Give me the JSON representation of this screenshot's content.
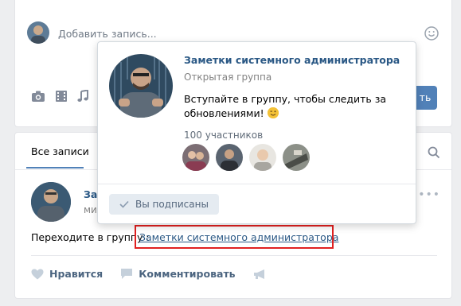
{
  "composer": {
    "placeholder": "Добавить запись...",
    "publish_label": "ть",
    "attach_icons": [
      "camera-icon",
      "video-icon",
      "music-icon"
    ]
  },
  "feed": {
    "tab_all": "Все записи",
    "post": {
      "author": "Зам",
      "date": "ми",
      "text_prefix": "Переходите в группу :",
      "link_text": "Заметки системного администратора",
      "like_label": "Нравится",
      "comment_label": "Комментировать"
    }
  },
  "popup": {
    "title": "Заметки системного администратора",
    "type": "Открытая группа",
    "description": "Вступайте в группу, чтобы следить за обновлениями!",
    "members_count": "100 участников",
    "subscribed_label": "Вы подписаны"
  },
  "colors": {
    "accent": "#5181b8",
    "link": "#2a5885",
    "highlight": "#e02020",
    "background": "#edeef0"
  }
}
